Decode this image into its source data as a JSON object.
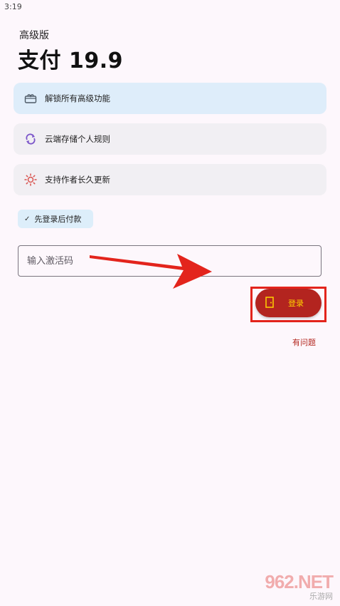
{
  "status_bar": {
    "time": "3:19"
  },
  "header": {
    "subtitle": "高级版",
    "title": "支付 19.9"
  },
  "features": [
    {
      "label": "解锁所有高级功能",
      "icon": "gift-box-icon"
    },
    {
      "label": "云端存储个人规则",
      "icon": "sync-icon"
    },
    {
      "label": "支持作者长久更新",
      "icon": "sun-icon"
    }
  ],
  "chip": {
    "label": "先登录后付款"
  },
  "activation": {
    "placeholder": "输入激活码",
    "value": ""
  },
  "login_button": {
    "label": "登录"
  },
  "help_link": {
    "label": "有问题"
  },
  "watermark": {
    "logo": "962.NET",
    "sub": "乐游网"
  },
  "colors": {
    "accent": "#b3241f",
    "accent_text": "#ffd200",
    "annotation": "#e3241c",
    "card_blue": "#deedfa",
    "card_gray": "#f1eff3"
  }
}
